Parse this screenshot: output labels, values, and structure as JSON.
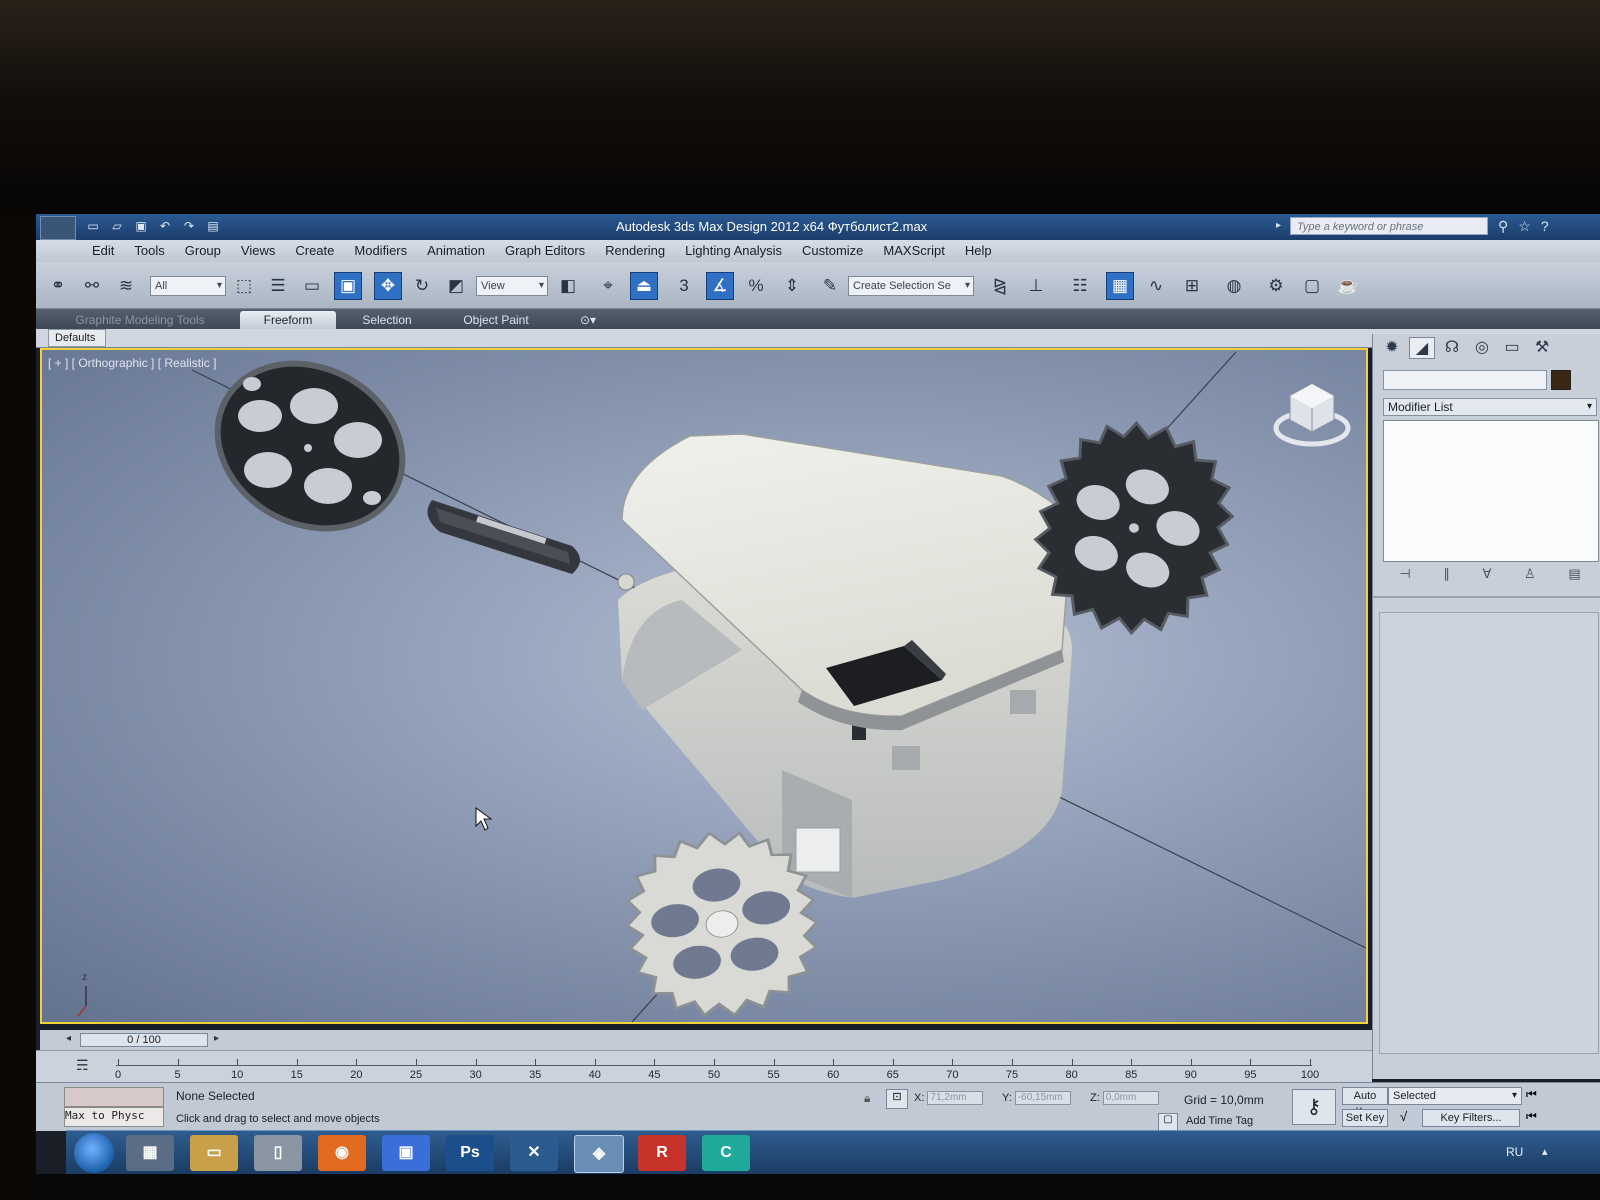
{
  "window": {
    "title": "Autodesk 3ds Max Design 2012 x64    Футболист2.max",
    "search_placeholder": "Type a keyword or phrase"
  },
  "menu": [
    "Edit",
    "Tools",
    "Group",
    "Views",
    "Create",
    "Modifiers",
    "Animation",
    "Graph Editors",
    "Rendering",
    "Lighting Analysis",
    "Customize",
    "MAXScript",
    "Help"
  ],
  "toolbar": {
    "filter_value": "All",
    "ref_coord_value": "View",
    "selection_set_placeholder": "Create Selection Se",
    "snap_label": "3"
  },
  "ribbon": {
    "tabs": [
      "Graphite Modeling Tools",
      "Freeform",
      "Selection",
      "Object Paint"
    ],
    "active_tab": "Freeform",
    "sub_label": "Defaults"
  },
  "viewport": {
    "label": "[ + ] [ Orthographic ] [ Realistic ]",
    "axis_label": "z"
  },
  "command_panel": {
    "modifier_list": "Modifier List"
  },
  "timeline": {
    "slider_label": "0 / 100",
    "ticks": [
      "0",
      "5",
      "10",
      "15",
      "20",
      "25",
      "30",
      "35",
      "40",
      "45",
      "50",
      "55",
      "60",
      "65",
      "70",
      "75",
      "80",
      "85",
      "90",
      "95",
      "100"
    ]
  },
  "status": {
    "maxscript_text": "Max to Physc",
    "selection_text": "None Selected",
    "prompt_text": "Click and drag to select and move objects",
    "x_label": "X:",
    "x_value": "71,2mm",
    "y_label": "Y:",
    "y_value": "-60,15mm",
    "z_label": "Z:",
    "z_value": "0,0mm",
    "grid_text": "Grid = 10,0mm",
    "add_time_tag": "Add Time Tag",
    "auto_key": "Auto Key",
    "set_key": "Set Key",
    "selected_value": "Selected",
    "key_filters": "Key Filters..."
  },
  "taskbar": {
    "language": "RU",
    "apps": [
      "Ps",
      "R",
      "C"
    ]
  },
  "colors": {
    "viewport_border": "#f1d23a",
    "title_bar": "#1b3d6b",
    "active_tool": "#2f6fc4"
  }
}
